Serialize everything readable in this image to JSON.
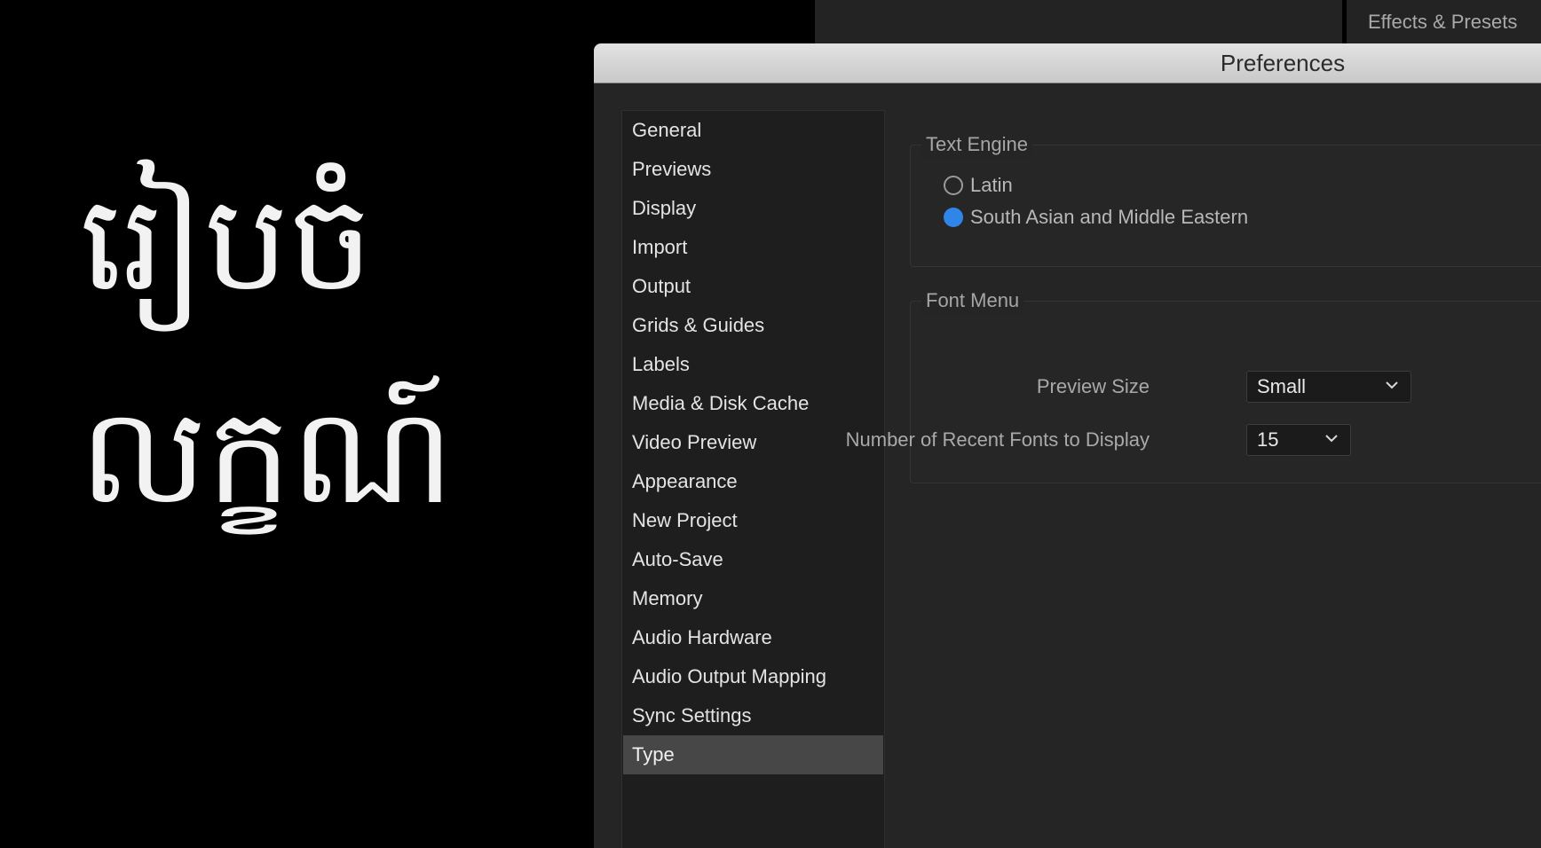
{
  "overlay_text": {
    "line1": "រៀបចំ",
    "line2": "លក្ខណ៍"
  },
  "top_bar": {
    "tab_label": "Effects & Presets"
  },
  "dialog": {
    "title": "Preferences"
  },
  "sidebar": {
    "items": [
      {
        "label": "General"
      },
      {
        "label": "Previews"
      },
      {
        "label": "Display"
      },
      {
        "label": "Import"
      },
      {
        "label": "Output"
      },
      {
        "label": "Grids & Guides"
      },
      {
        "label": "Labels"
      },
      {
        "label": "Media & Disk Cache"
      },
      {
        "label": "Video Preview"
      },
      {
        "label": "Appearance"
      },
      {
        "label": "New Project"
      },
      {
        "label": "Auto-Save"
      },
      {
        "label": "Memory"
      },
      {
        "label": "Audio Hardware"
      },
      {
        "label": "Audio Output Mapping"
      },
      {
        "label": "Sync Settings"
      },
      {
        "label": "Type"
      }
    ],
    "selected": "Type"
  },
  "text_engine": {
    "title": "Text Engine",
    "options": [
      {
        "label": "Latin",
        "checked": false
      },
      {
        "label": "South Asian and Middle Eastern",
        "checked": true
      }
    ]
  },
  "font_menu": {
    "title": "Font Menu",
    "preview_size": {
      "label": "Preview Size",
      "value": "Small"
    },
    "recent_fonts": {
      "label": "Number of Recent Fonts to Display",
      "value": "15"
    }
  },
  "colors": {
    "accent": "#2f86e8",
    "selected_item": "#474747"
  },
  "icons": {
    "dropdown_arrow": "chevron-down-icon",
    "radio": "radio-button-icon"
  }
}
